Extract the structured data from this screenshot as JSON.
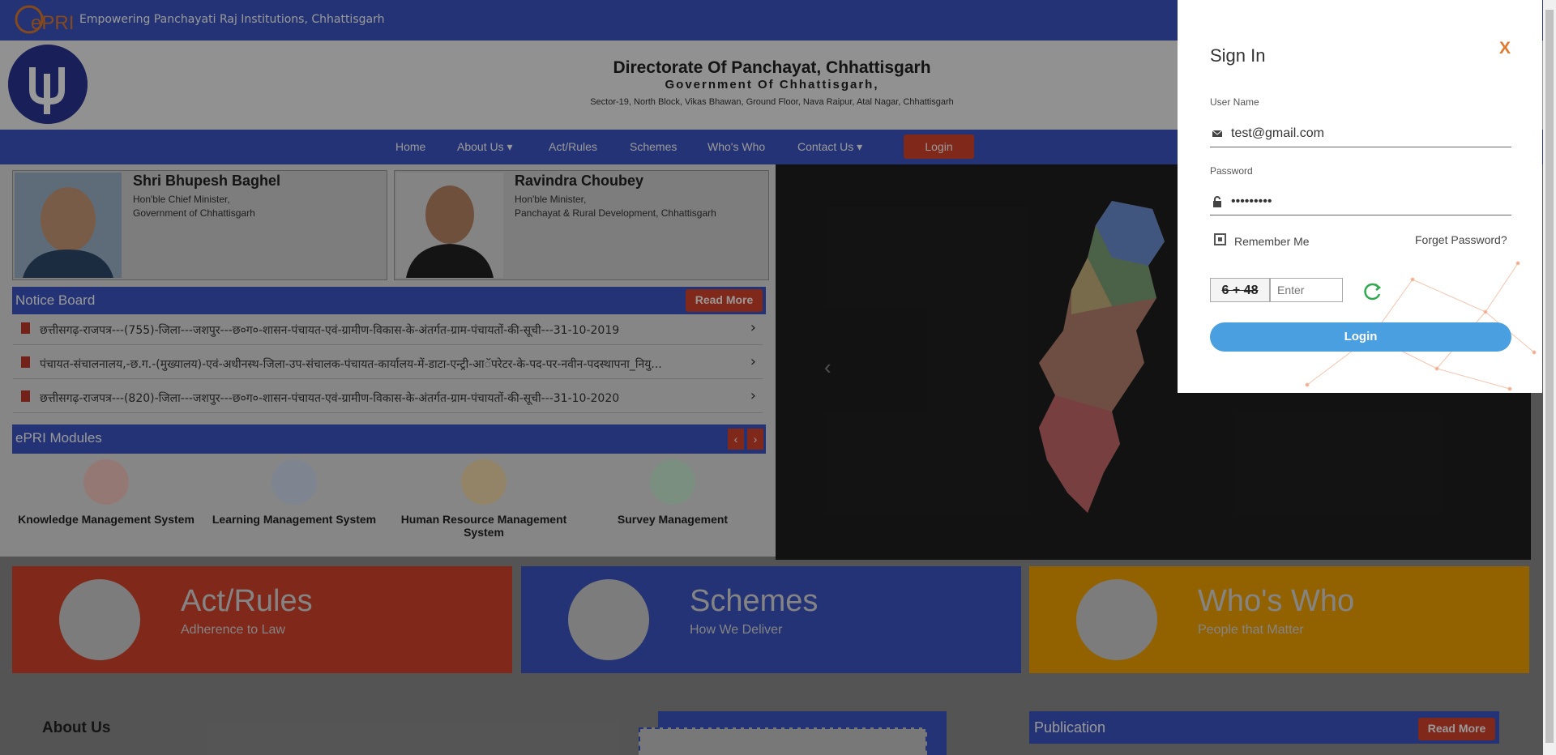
{
  "topbar": {
    "logo_text": "ePRI",
    "tagline": "Empowering Panchayati Raj Institutions, Chhattisgarh"
  },
  "header": {
    "title": "Directorate Of Panchayat, Chhattisgarh",
    "subtitle": "Government Of Chhattisgarh,",
    "address": "Sector-19, North Block, Vikas Bhawan, Ground Floor, Nava Raipur, Atal Nagar, Chhattisgarh"
  },
  "nav": {
    "items": [
      "Home",
      "About Us",
      "Act/Rules",
      "Schemes",
      "Who's Who",
      "Contact Us"
    ],
    "dropdown_marker": "▾",
    "login": "Login"
  },
  "leaders": [
    {
      "name": "Shri Bhupesh Baghel",
      "role1": "Hon'ble Chief Minister,",
      "role2": "Government of Chhattisgarh"
    },
    {
      "name": "Ravindra Choubey",
      "role1": "Hon'ble Minister,",
      "role2": "Panchayat & Rural Development, Chhattisgarh"
    }
  ],
  "notice_board": {
    "title": "Notice Board",
    "read_more": "Read More",
    "items": [
      "छत्तीसगढ़-राजपत्र---(755)-जिला---जशपुर---छ०ग०-शासन-पंचायत-एवं-ग्रामीण-विकास-के-अंतर्गत-ग्राम-पंचायतों-की-सूची---31-10-2019",
      "पंचायत-संचालनालय,-छ.ग.-(मुख्यालय)-एवं-अधीनस्थ-जिला-उप-संचालक-पंचायत-कार्यालय-में-डाटा-एन्ट्री-आॅपरेटर-के-पद-पर-नवीन-पदस्थापना_नियु...",
      "छत्तीसगढ़-राजपत्र---(820)-जिला---जशपुर---छ०ग०-शासन-पंचायत-एवं-ग्रामीण-विकास-के-अंतर्गत-ग्राम-पंचायतों-की-सूची---31-10-2020"
    ],
    "chevron": "›"
  },
  "modules": {
    "title": "ePRI Modules",
    "prev": "‹",
    "next": "›",
    "items": [
      {
        "label": "Knowledge Management System",
        "icon": "brain-bulb-icon",
        "color": "#f7c9c0"
      },
      {
        "label": "Learning Management System",
        "icon": "elearning-icon",
        "color": "#d2dcf0"
      },
      {
        "label": "Human Resource Management System",
        "icon": "hr-gear-icon",
        "color": "#f6dcae"
      },
      {
        "label": "Survey Management",
        "icon": "survey-checklist-icon",
        "color": "#cdeed8"
      }
    ]
  },
  "slider": {
    "prev": "‹"
  },
  "tiles": [
    {
      "title": "Act/Rules",
      "subtitle": "Adherence to Law",
      "icon": "scales-icon",
      "color": "#d6432b"
    },
    {
      "title": "Schemes",
      "subtitle": "How We Deliver",
      "icon": "network-icon",
      "color": "#3c56c4"
    },
    {
      "title": "Who's Who",
      "subtitle": "People that Matter",
      "icon": "hierarchy-icon",
      "color": "#f5a300"
    }
  ],
  "about": {
    "title": "About Us"
  },
  "publication": {
    "title": "Publication",
    "read_more": "Read More"
  },
  "signin": {
    "title": "Sign In",
    "close": "X",
    "username_label": "User Name",
    "username_value": "test@gmail.com",
    "password_label": "Password",
    "password_value": "•••••••••",
    "remember": "Remember Me",
    "forgot": "Forget Password?",
    "captcha": "6 + 48",
    "captcha_placeholder": "Enter",
    "login": "Login",
    "accent": "#4a9fe0"
  }
}
